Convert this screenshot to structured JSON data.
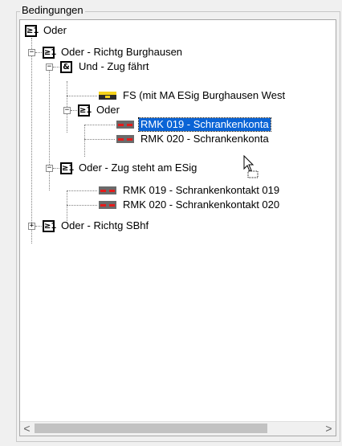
{
  "group": {
    "title": "Bedingungen"
  },
  "tree": {
    "nodes": [
      {
        "icon": "gate-or",
        "gate_symbol": "≥1",
        "label": "Oder"
      },
      {
        "icon": "gate-or",
        "gate_symbol": "≥1",
        "label": "Oder - Richtg Burghausen"
      },
      {
        "icon": "gate-and",
        "gate_symbol": "&",
        "label": "Und - Zug fährt"
      },
      {
        "icon": "fs-icon",
        "label": "FS (mit MA ESig Burghausen West"
      },
      {
        "icon": "gate-or",
        "gate_symbol": "≥1",
        "label": "Oder"
      },
      {
        "icon": "contact-icon",
        "label": "RMK 019 - Schrankenkonta"
      },
      {
        "icon": "contact-icon",
        "label": "RMK 020 - Schrankenkonta"
      },
      {
        "icon": "gate-or",
        "gate_symbol": "≥1",
        "label": "Oder - Zug steht am ESig"
      },
      {
        "icon": "contact-icon",
        "label": "RMK 019 - Schrankenkontakt 019"
      },
      {
        "icon": "contact-icon",
        "label": "RMK 020 - Schrankenkontakt 020"
      },
      {
        "icon": "gate-or",
        "gate_symbol": "≥1",
        "label": "Oder - Richtg SBhf"
      }
    ],
    "expander_minus": "−",
    "expander_plus": "+"
  },
  "scrollbar": {
    "left_arrow": "<",
    "right_arrow": ">"
  }
}
